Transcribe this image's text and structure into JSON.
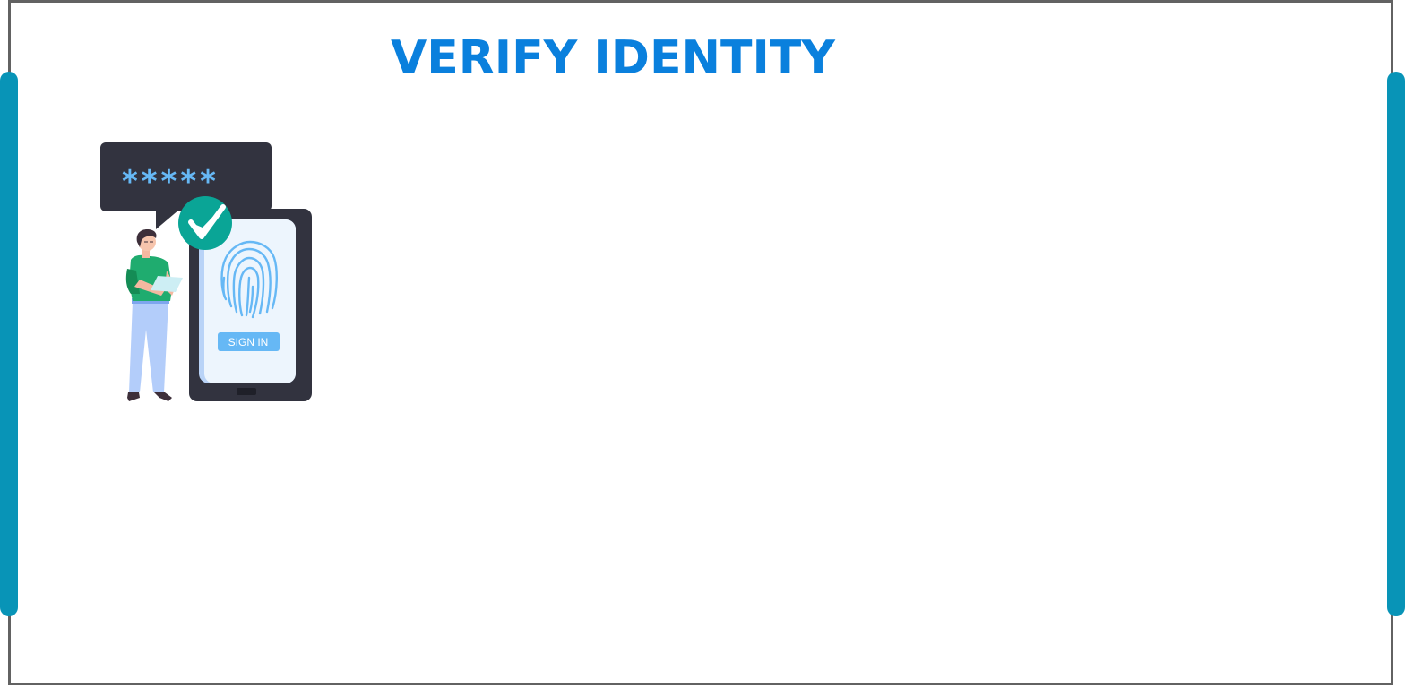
{
  "page": {
    "title": "VERIFY IDENTITY"
  },
  "illustration": {
    "password_mask": "*****",
    "signin_label": "SIGN IN",
    "icons": [
      "password-bubble-icon",
      "check-badge-icon",
      "fingerprint-icon",
      "person-icon",
      "tablet-device-icon"
    ]
  },
  "colors": {
    "accent_bar": "#0894b7",
    "title": "#0a80dd",
    "frame_border": "#626262",
    "dark_device": "#32333f",
    "check_badge": "#0aa596",
    "mask_stars": "#66b8f5"
  }
}
